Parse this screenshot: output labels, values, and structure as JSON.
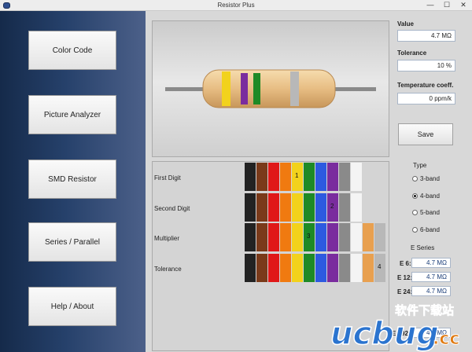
{
  "window": {
    "title": "Resistor Plus",
    "controls": {
      "minimize": "—",
      "maximize": "☐",
      "close": "✕"
    }
  },
  "sidebar": {
    "buttons": [
      {
        "label": "Color Code"
      },
      {
        "label": "Picture Analyzer"
      },
      {
        "label": "SMD Resistor"
      },
      {
        "label": "Series / Parallel"
      },
      {
        "label": "Help / About"
      }
    ]
  },
  "resistor": {
    "bands": [
      {
        "name": "yellow",
        "color": "#f2d21c"
      },
      {
        "name": "violet",
        "color": "#7a2c9e"
      },
      {
        "name": "green",
        "color": "#1e8a26"
      },
      {
        "name": "silver",
        "color": "#b8b8b8"
      }
    ]
  },
  "results": {
    "value_label": "Value",
    "value": "4.7 MΩ",
    "tolerance_label": "Tolerance",
    "tolerance": "10 %",
    "tempco_label": "Temperature coeff.",
    "tempco": "0 ppm/k",
    "save_label": "Save"
  },
  "band_table": {
    "rows": [
      {
        "label": "First Digit",
        "swatches": [
          "#222222",
          "#7a3a1a",
          "#e01818",
          "#f07a10",
          "#f2d21c",
          "#1e8a26",
          "#2d5ae0",
          "#7a2c9e",
          "#8a8a8a",
          "#f4f4f4"
        ],
        "selected": 4,
        "mark": "1"
      },
      {
        "label": "Second Digit",
        "swatches": [
          "#222222",
          "#7a3a1a",
          "#e01818",
          "#f07a10",
          "#f2d21c",
          "#1e8a26",
          "#2d5ae0",
          "#7a2c9e",
          "#8a8a8a",
          "#f4f4f4"
        ],
        "selected": 7,
        "mark": "2"
      },
      {
        "label": "Multiplier",
        "swatches": [
          "#222222",
          "#7a3a1a",
          "#e01818",
          "#f07a10",
          "#f2d21c",
          "#1e8a26",
          "#2d5ae0",
          "#7a2c9e",
          "#8a8a8a",
          "#f4f4f4",
          "#e8a050",
          "#b8b8b8"
        ],
        "selected": 5,
        "mark": "3"
      },
      {
        "label": "Tolerance",
        "swatches": [
          "#222222",
          "#7a3a1a",
          "#e01818",
          "#f07a10",
          "#f2d21c",
          "#1e8a26",
          "#2d5ae0",
          "#7a2c9e",
          "#8a8a8a",
          "#f4f4f4",
          "#e8a050",
          "#b8b8b8"
        ],
        "selected": 11,
        "mark": "4"
      }
    ]
  },
  "type_group": {
    "title": "Type",
    "options": [
      {
        "label": "3-band",
        "checked": false
      },
      {
        "label": "4-band",
        "checked": true
      },
      {
        "label": "5-band",
        "checked": false
      },
      {
        "label": "6-band",
        "checked": false
      }
    ]
  },
  "e_series": {
    "title": "E Series",
    "rows": [
      {
        "label": "E 6:",
        "value": "4.7 MΩ"
      },
      {
        "label": "E 12:",
        "value": "4.7 MΩ"
      },
      {
        "label": "E 24:",
        "value": "4.7 MΩ"
      },
      {
        "label": "E 192:",
        "value": "4.7 MΩ"
      }
    ]
  },
  "watermark": {
    "cn": "软件下载站",
    "brand": "ucbug",
    "tld": ".cc"
  }
}
